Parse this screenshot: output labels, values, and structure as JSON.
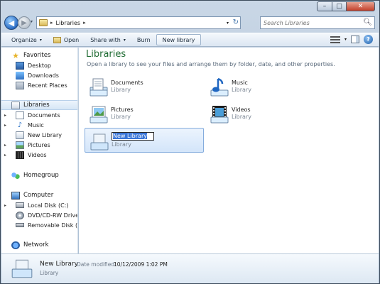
{
  "window": {
    "caption_buttons": {
      "minimize": "–",
      "maximize": "□",
      "close": "✕"
    }
  },
  "address": {
    "back_glyph": "◀",
    "forward_glyph": "▶",
    "path_separator": "▸",
    "crumb": "Libraries",
    "dropdown_glyph": "▾",
    "refresh_glyph": "↻"
  },
  "search": {
    "placeholder": "Search Libraries",
    "icon": "search-icon"
  },
  "toolbar": {
    "organize": "Organize",
    "open": "Open",
    "share_with": "Share with",
    "burn": "Burn",
    "new_library": "New library",
    "dropdown_glyph": "▾",
    "help_glyph": "?"
  },
  "nav": {
    "favorites": {
      "label": "Favorites",
      "items": [
        "Desktop",
        "Downloads",
        "Recent Places"
      ]
    },
    "libraries": {
      "label": "Libraries",
      "items": [
        "Documents",
        "Music",
        "New Library",
        "Pictures",
        "Videos"
      ]
    },
    "homegroup": "Homegroup",
    "computer": {
      "label": "Computer",
      "items": [
        "Local Disk (C:)",
        "DVD/CD-RW Drive (I",
        "Removable Disk (E:)"
      ]
    },
    "network": "Network",
    "expander_glyph": "▸",
    "star_glyph": "★",
    "note_glyph": "♪"
  },
  "content": {
    "title": "Libraries",
    "subtitle": "Open a library to see your files and arrange them by folder, date, and other properties.",
    "libraries": [
      {
        "name": "Documents",
        "type": "Library",
        "icon": "documents-library-icon"
      },
      {
        "name": "Music",
        "type": "Library",
        "icon": "music-library-icon"
      },
      {
        "name": "Pictures",
        "type": "Library",
        "icon": "pictures-library-icon"
      },
      {
        "name": "Videos",
        "type": "Library",
        "icon": "videos-library-icon"
      },
      {
        "name": "New Library",
        "type": "Library",
        "icon": "new-library-icon",
        "renaming": true
      }
    ]
  },
  "details": {
    "name": "New Library",
    "modified_label": "Date modified:",
    "modified_value": "10/12/2009 1:02 PM",
    "type": "Library"
  },
  "colors": {
    "title_green": "#1e6b32",
    "selection_blue": "#3875d7",
    "selected_item_bg": "#d3e5fa"
  }
}
